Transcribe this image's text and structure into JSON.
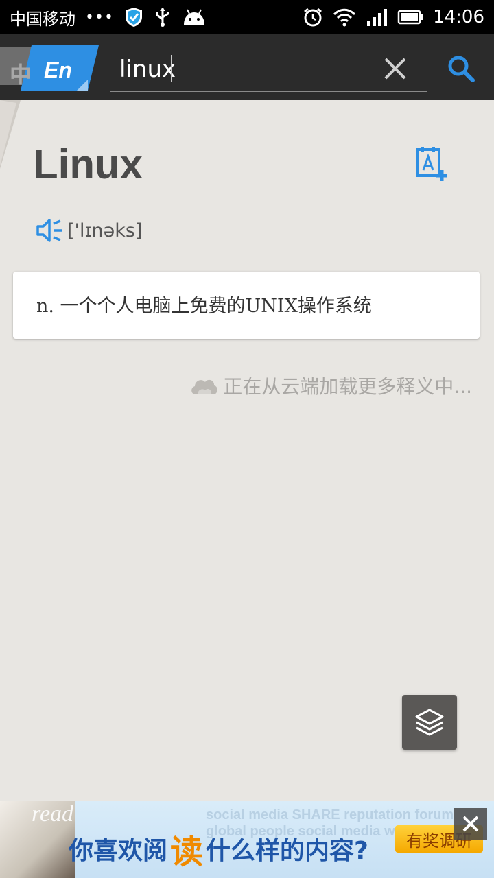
{
  "status_bar": {
    "carrier": "中国移动",
    "dots": "•••",
    "time": "14:06"
  },
  "toolbar": {
    "lang_back_label": "中",
    "lang_front_label": "En",
    "search_value": "linux",
    "search_placeholder": "",
    "accent_color": "#2e8fe3"
  },
  "entry": {
    "word": "Linux",
    "phonetic": "['lɪnəks]",
    "definition": "n. 一个个人电脑上免费的UNIX操作系统",
    "loading_text": "正在从云端加载更多释义中..."
  },
  "ad": {
    "read_label": "read",
    "headline_part1": "你喜欢阅",
    "headline_highlight": "读",
    "headline_part2": "什么样的内容?",
    "cta_label": "有奖调研",
    "background_words": "social media SHARE reputation forum global people social media website"
  }
}
